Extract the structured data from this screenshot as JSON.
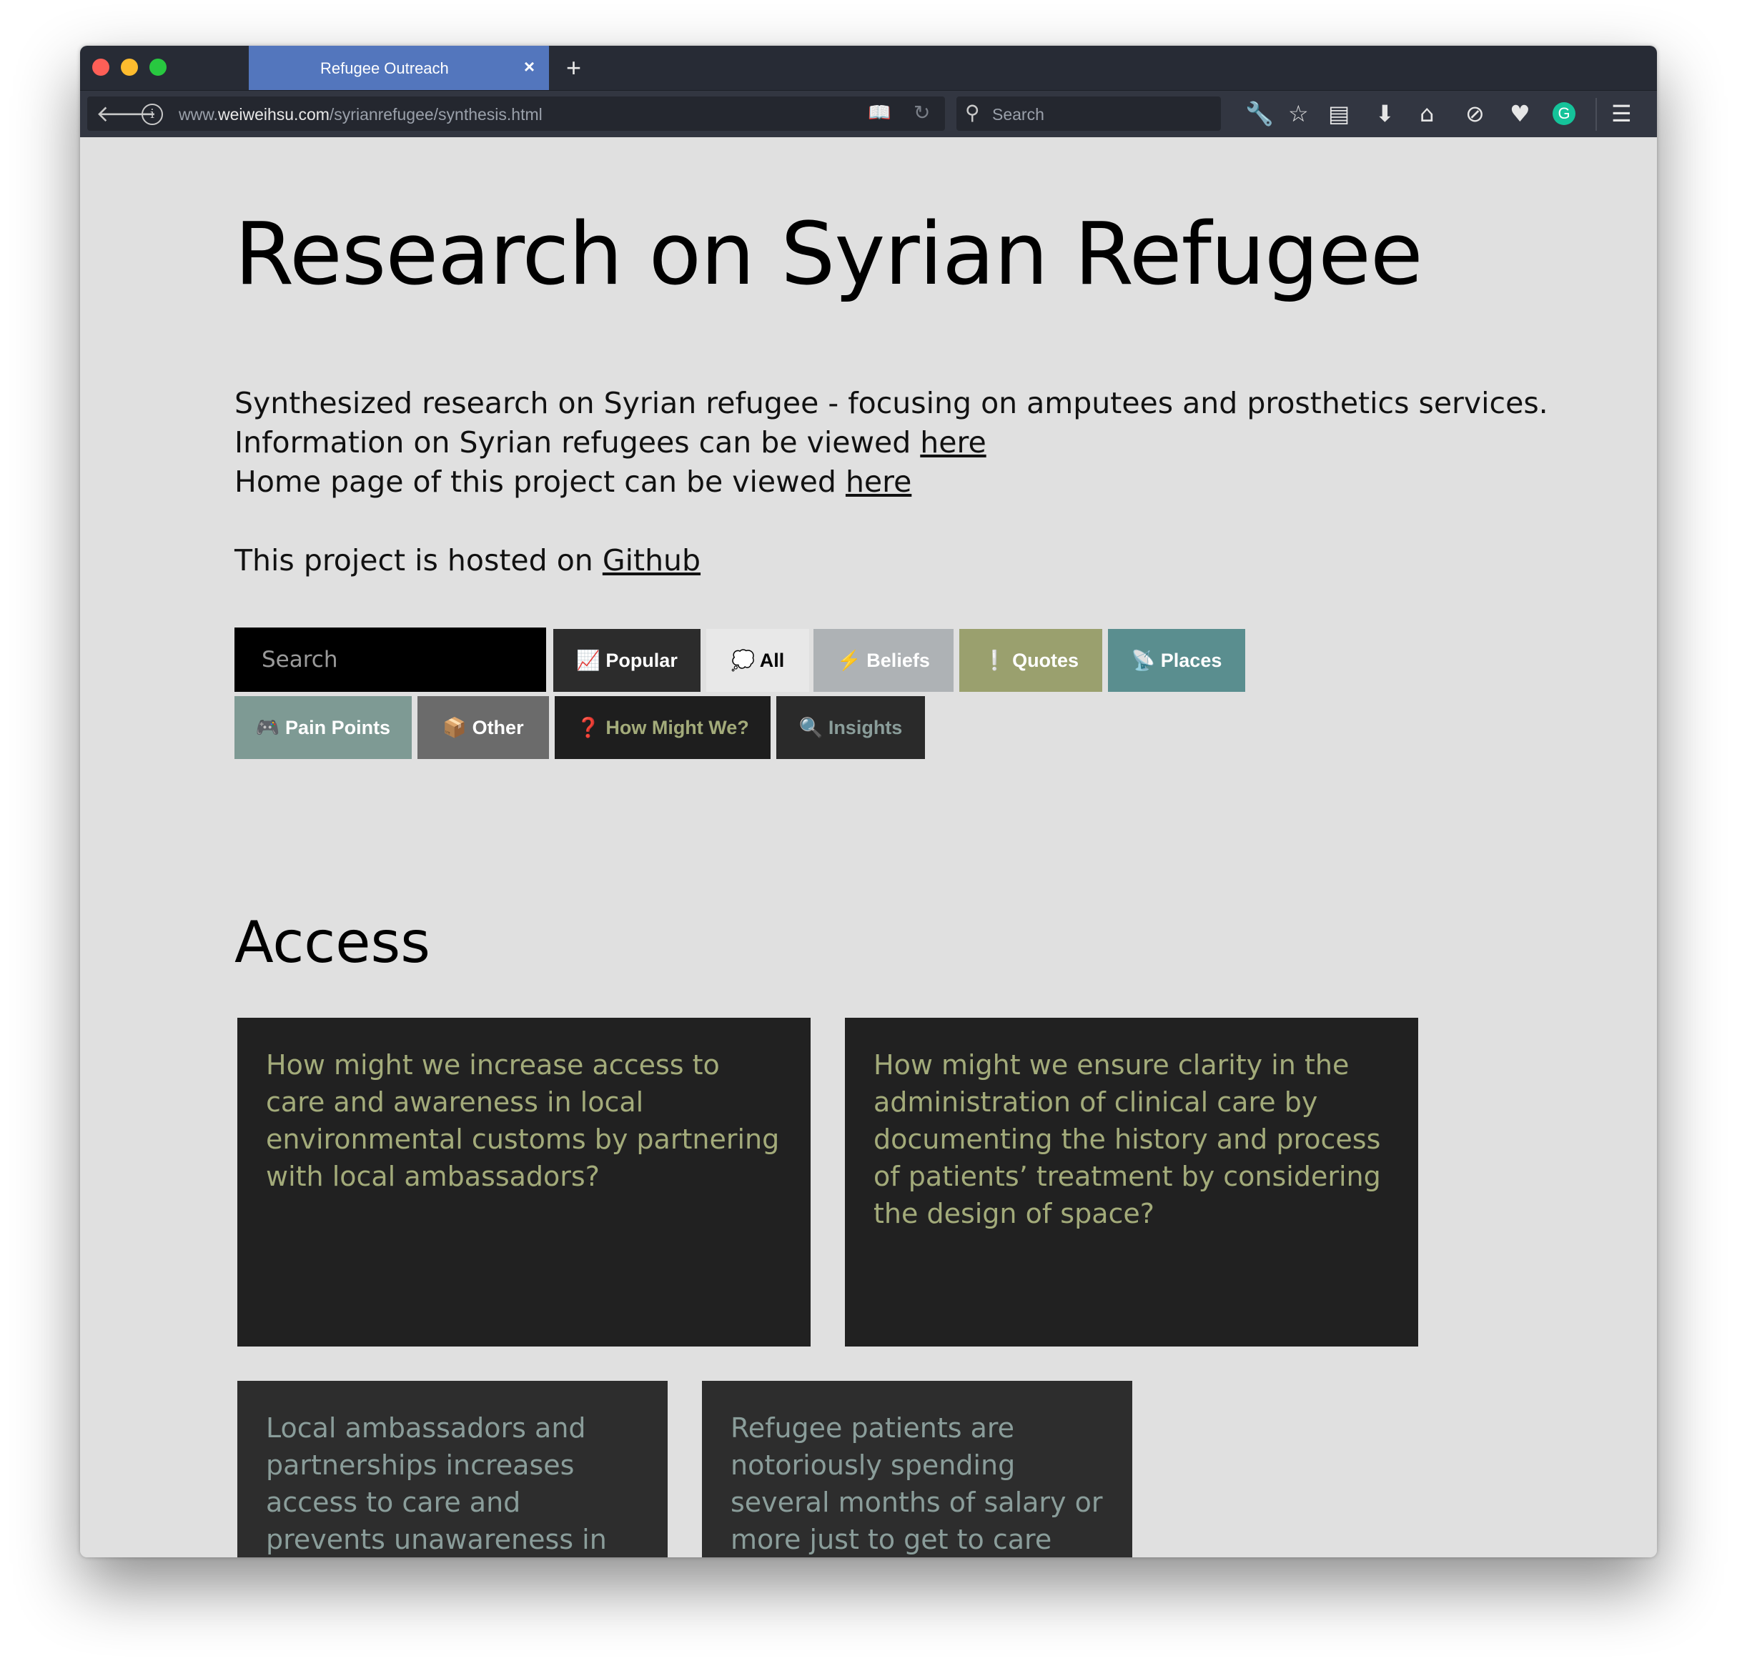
{
  "browser": {
    "tab_title": "Refugee Outreach",
    "tab_close": "×",
    "new_tab": "+",
    "url_prefix": "www.",
    "url_domain": "weiweihsu.com",
    "url_path": "/syrianrefugee/synthesis.html",
    "search_placeholder": "Search"
  },
  "page": {
    "title": "Research on Syrian Refugee",
    "intro_line1": "Synthesized research on Syrian refugee - focusing on amputees and prosthetics services.",
    "intro_line2": "Information on Syrian refugees can be viewed ",
    "intro_line2_link": "here",
    "intro_line3": "Home page of this project can be viewed ",
    "intro_line3_link": "here",
    "intro_line4": "This project is hosted on ",
    "intro_line4_link": "Github"
  },
  "filters": {
    "search_placeholder": "Search",
    "buttons": [
      {
        "label": "Popular",
        "icon": "📈",
        "bg": "#2c2c2c",
        "color": "#ffffff"
      },
      {
        "label": "All",
        "icon": "💭",
        "bg": "#e8e8e8",
        "color": "#000000"
      },
      {
        "label": "Beliefs",
        "icon": "⚡",
        "bg": "#aeb2b5",
        "color": "#ffffff"
      },
      {
        "label": "Quotes",
        "icon": "❕",
        "bg": "#9aa06e",
        "color": "#ffffff"
      },
      {
        "label": "Places",
        "icon": "📡",
        "bg": "#5a8e8f",
        "color": "#ffffff"
      },
      {
        "label": "Pain Points",
        "icon": "🎮",
        "bg": "#7e9a94",
        "color": "#ffffff"
      },
      {
        "label": "Other",
        "icon": "📦",
        "bg": "#6b6b6b",
        "color": "#ffffff"
      },
      {
        "label": "How Might We?",
        "icon": "❓",
        "bg": "#1e1e1e",
        "color": "#a3ab7a"
      },
      {
        "label": "Insights",
        "icon": "🔍",
        "bg": "#2a2a2a",
        "color": "#8a9d9a"
      }
    ]
  },
  "section": {
    "title": "Access",
    "cards": [
      {
        "type": "how-might-we",
        "text": "How might we increase access to care and awareness in local environmental customs by partnering with local ambassadors?"
      },
      {
        "type": "how-might-we",
        "text": "How might we ensure clarity in the administration of clinical care by documenting the history and process of patients’ treatment by considering the design of space?"
      },
      {
        "type": "insight",
        "text": "Local ambassadors and partnerships increases access to care and prevents unawareness in local customs."
      },
      {
        "type": "insight",
        "text": "Refugee patients are notoriously spending several months of salary or more just to get to care centers."
      }
    ]
  }
}
